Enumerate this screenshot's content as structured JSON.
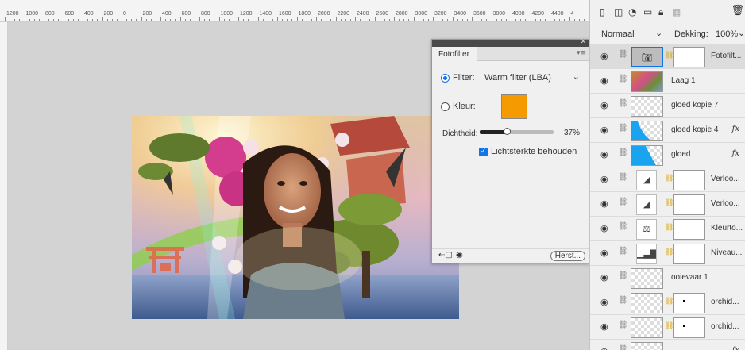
{
  "ruler": {
    "labels": [
      "1200",
      "1000",
      "800",
      "600",
      "400",
      "200",
      "0",
      "200",
      "400",
      "600",
      "800",
      "1000",
      "1200",
      "1400",
      "1600",
      "1800",
      "2000",
      "2200",
      "2400",
      "2600",
      "2800",
      "3000",
      "3200",
      "3400",
      "3600",
      "3800",
      "4000",
      "4200",
      "4400",
      "4"
    ]
  },
  "photo_filter": {
    "tab_title": "Fotofilter",
    "menu_icon": "panel-menu-icon",
    "filter_label": "Filter:",
    "filter_value": "Warm filter (LBA)",
    "color_label": "Kleur:",
    "color_value": "#f59a00",
    "density_label": "Dichtheid:",
    "density_value": "37%",
    "density_fraction": 0.37,
    "preserve_luminosity_label": "Lichtsterkte behouden",
    "preserve_luminosity_checked": true,
    "reset_label": "Herst..."
  },
  "layers": {
    "blend_mode": "Normaal",
    "opacity_label": "Dekking:",
    "opacity_value": "100%",
    "items": [
      {
        "name": "Fotofilt...",
        "kind": "adjustment-photo-filter",
        "selected": true
      },
      {
        "name": "Laag 1",
        "kind": "photo"
      },
      {
        "name": "gloed kopie 7",
        "kind": "transparent"
      },
      {
        "name": "gloed kopie 4",
        "kind": "blue-shape",
        "fx": "fx"
      },
      {
        "name": "gloed",
        "kind": "blue-fill",
        "fx": "fx"
      },
      {
        "name": "Verloo...",
        "kind": "adjustment-gradient"
      },
      {
        "name": "Verloo...",
        "kind": "adjustment-gradient"
      },
      {
        "name": "Kleurto...",
        "kind": "adjustment-colorbalance"
      },
      {
        "name": "Niveau...",
        "kind": "adjustment-levels"
      },
      {
        "name": "ooievaar 1",
        "kind": "transparent"
      },
      {
        "name": "orchid...",
        "kind": "masked"
      },
      {
        "name": "orchid...",
        "kind": "masked"
      },
      {
        "name": "",
        "kind": "transparent",
        "fx": "fx"
      }
    ]
  },
  "colors": {
    "accent": "#1473e6",
    "swatch": "#f59a00",
    "layer_blue": "#1aa3ee"
  }
}
